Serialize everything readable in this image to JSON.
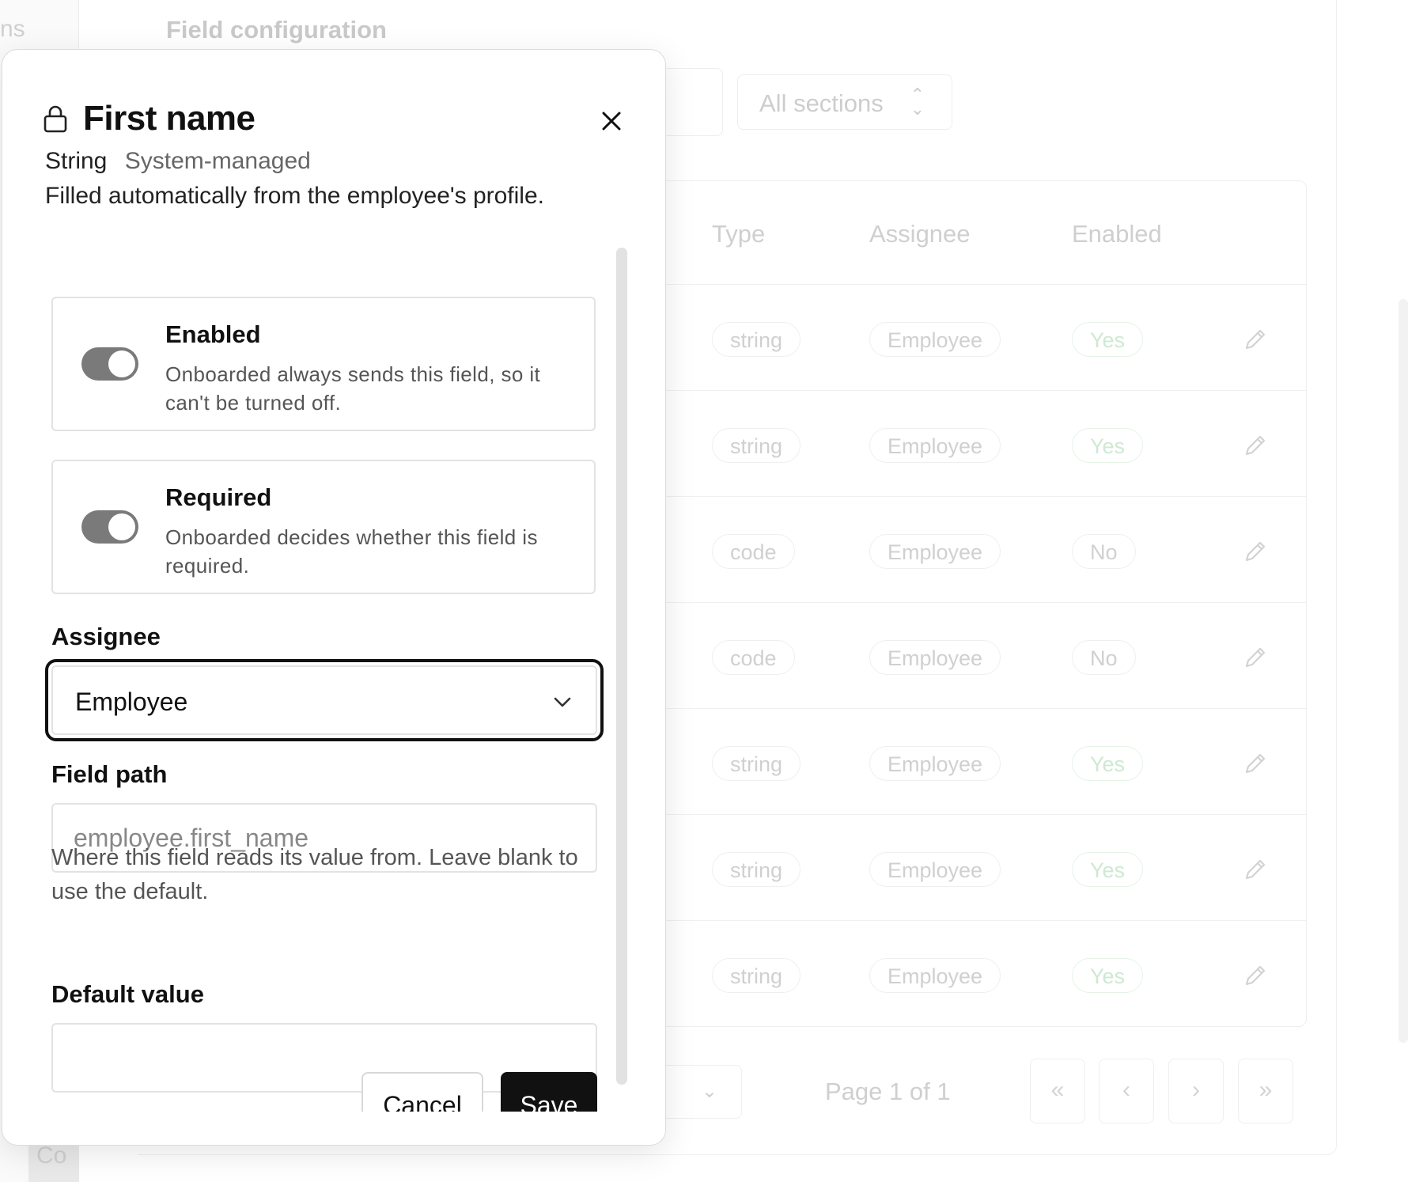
{
  "background": {
    "sidebar_fragment": "ns",
    "sidebar_bottom_fragment": "Co",
    "page_title": "Field configuration",
    "section_filter": "All sections",
    "columns": [
      "Type",
      "Assignee",
      "Enabled"
    ],
    "rows": [
      {
        "type": "string",
        "assignee": "Employee",
        "enabled": "Yes"
      },
      {
        "type": "string",
        "assignee": "Employee",
        "enabled": "Yes"
      },
      {
        "type": "code",
        "assignee": "Employee",
        "enabled": "No"
      },
      {
        "type": "code",
        "assignee": "Employee",
        "enabled": "No"
      },
      {
        "type": "string",
        "assignee": "Employee",
        "enabled": "Yes"
      },
      {
        "type": "string",
        "assignee": "Employee",
        "enabled": "Yes"
      },
      {
        "type": "string",
        "assignee": "Employee",
        "enabled": "Yes"
      }
    ],
    "pagination": {
      "label": "Page 1 of 1",
      "first": "«",
      "prev": "‹",
      "next": "›",
      "last": "»"
    }
  },
  "modal": {
    "title": "First name",
    "type": "String",
    "managed": "System-managed",
    "description": "Filled automatically from the employee's profile.",
    "enabled": {
      "title": "Enabled",
      "description": "Onboarded always sends this field, so it can't be turned off.",
      "state": "on"
    },
    "required": {
      "title": "Required",
      "description": "Onboarded decides whether this field is required.",
      "state": "on"
    },
    "assignee": {
      "label": "Assignee",
      "value": "Employee"
    },
    "field_path": {
      "label": "Field path",
      "placeholder": "employee.first_name",
      "value": "",
      "help": "Where this field reads its value from. Leave blank to use the default."
    },
    "default_value": {
      "label": "Default value",
      "value": ""
    },
    "cancel_label": "Cancel",
    "save_label": "Save"
  },
  "colors": {
    "accent": "#111111",
    "toggle_disabled": "#7a7a7a",
    "badge_yes": "#cfe8d2"
  },
  "icons": {
    "title": "lock-icon",
    "close": "close-icon",
    "select": "chevron-down-icon",
    "row_action": "pencil-icon"
  }
}
